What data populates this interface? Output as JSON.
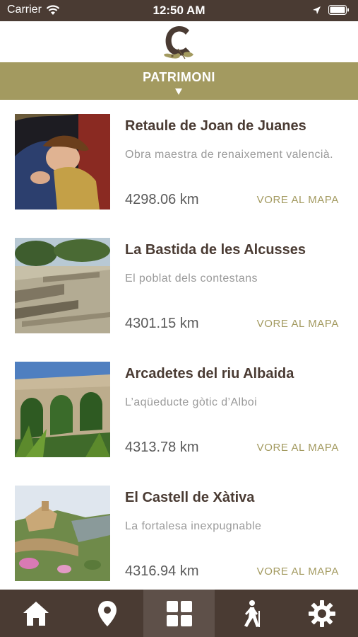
{
  "status": {
    "carrier": "Carrier",
    "time": "12:50 AM"
  },
  "header": {
    "section_title": "PATRIMONI"
  },
  "items": [
    {
      "name": "Retaule de Joan de Juanes",
      "description": "Obra maestra de renaixement valencià.",
      "distance": "4298.06 km",
      "map_label": "VORE AL MAPA"
    },
    {
      "name": "La Bastida de les Alcusses",
      "description": "El poblat dels contestans",
      "distance": "4301.15 km",
      "map_label": "VORE AL MAPA"
    },
    {
      "name": "Arcadetes del riu Albaida",
      "description": "L’aqüeducte gòtic d’Alboi",
      "distance": "4313.78 km",
      "map_label": "VORE AL MAPA"
    },
    {
      "name": "El Castell de Xàtiva",
      "description": "La fortalesa inexpugnable",
      "distance": "4316.94 km",
      "map_label": "VORE AL MAPA"
    }
  ],
  "tabs": [
    {
      "icon": "home-icon"
    },
    {
      "icon": "map-pin-icon"
    },
    {
      "icon": "grid-icon",
      "active": true
    },
    {
      "icon": "hiker-icon"
    },
    {
      "icon": "gear-icon"
    }
  ],
  "colors": {
    "brown": "#4a3b33",
    "olive": "#a39a60",
    "active_tab": "#5e5049"
  }
}
